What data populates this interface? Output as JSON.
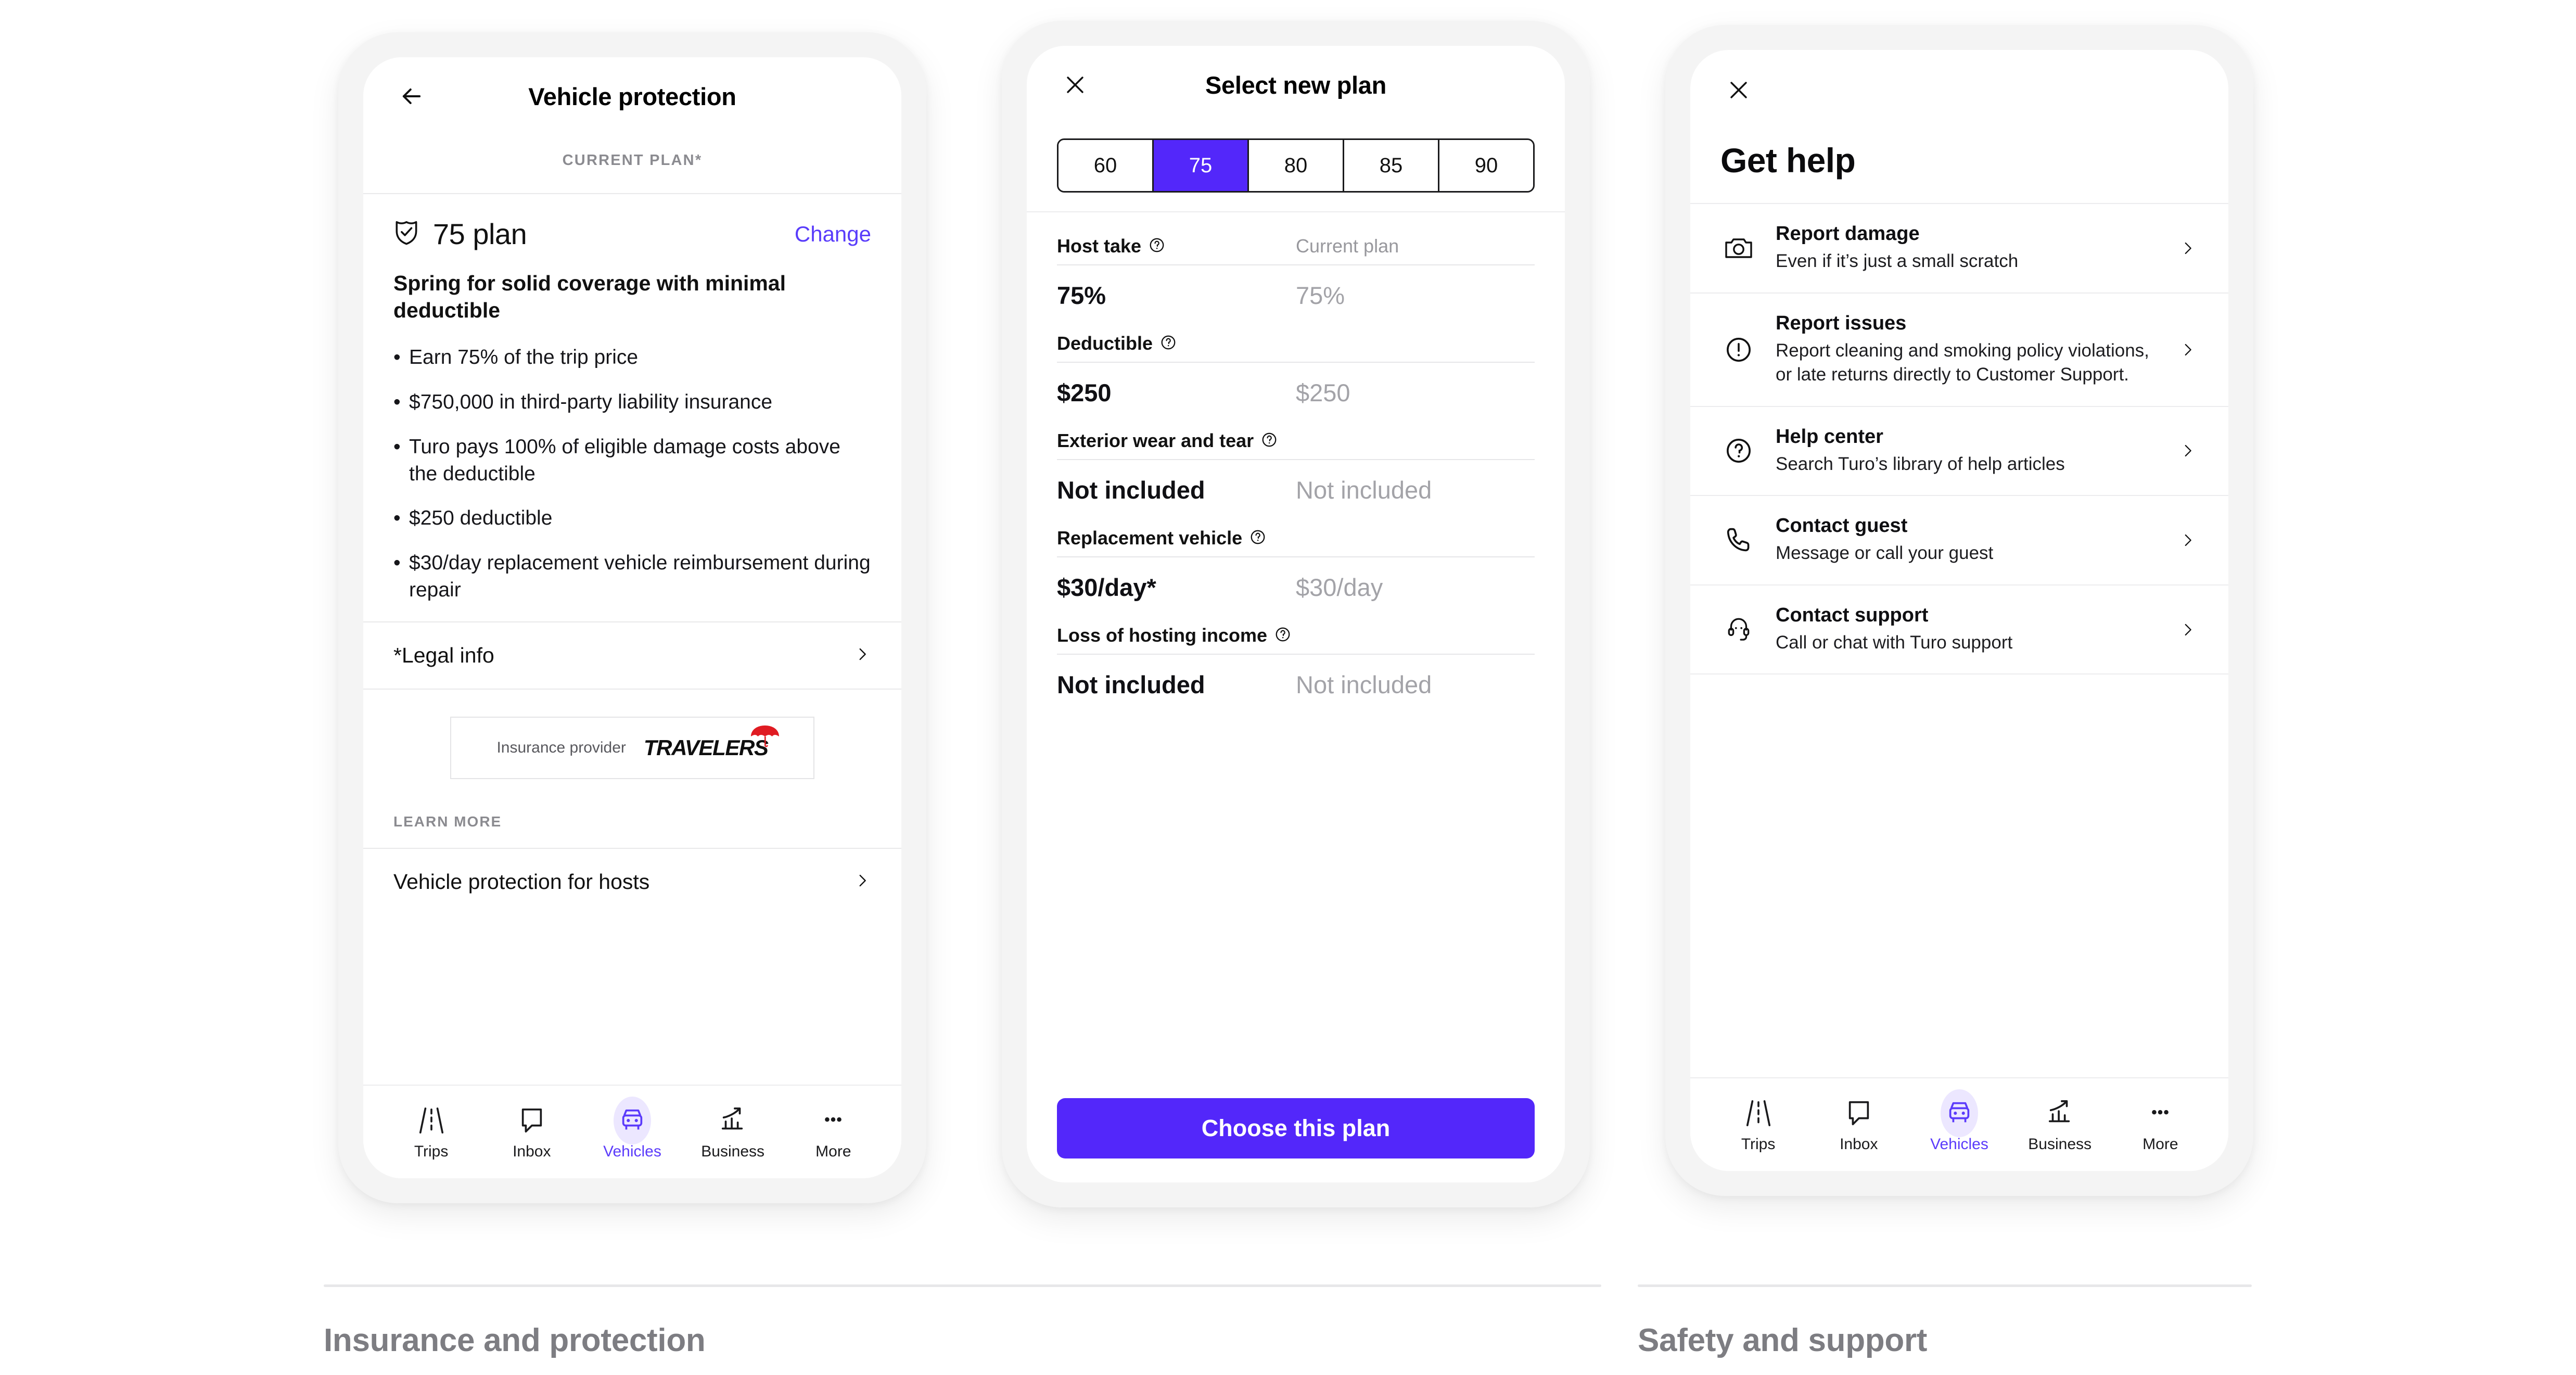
{
  "colors": {
    "accent": "#5327fa",
    "accent_link": "#593cfb",
    "muted": "#98989d",
    "frame": "#f4f4f4"
  },
  "phone1": {
    "appbar": {
      "back_icon": "arrow-left-icon",
      "title": "Vehicle protection"
    },
    "section_label": "CURRENT PLAN*",
    "plan": {
      "shield_icon": "shield-check-icon",
      "name": "75 plan",
      "change_label": "Change",
      "tagline": "Spring for solid coverage with minimal deductible",
      "bullets": [
        "Earn 75% of the trip price",
        "$750,000 in third-party liability insurance",
        "Turo pays 100% of eligible damage costs above the deductible",
        "$250 deductible",
        "$30/day replacement vehicle reimbursement during repair"
      ]
    },
    "legal_row": {
      "label": "*Legal info",
      "chevron_icon": "chevron-right-icon"
    },
    "provider": {
      "label": "Insurance provider",
      "brand": "TRAVELERS",
      "brand_icon": "red-umbrella-icon"
    },
    "learn_more_label": "LEARN MORE",
    "learn_more_row": {
      "label": "Vehicle protection for hosts",
      "chevron_icon": "chevron-right-icon"
    },
    "tabs": [
      {
        "label": "Trips",
        "icon": "road-icon",
        "active": false
      },
      {
        "label": "Inbox",
        "icon": "speech-bubble-icon",
        "active": false
      },
      {
        "label": "Vehicles",
        "icon": "car-front-icon",
        "active": true
      },
      {
        "label": "Business",
        "icon": "bar-chart-arrow-icon",
        "active": false
      },
      {
        "label": "More",
        "icon": "ellipsis-icon",
        "active": false
      }
    ]
  },
  "phone2": {
    "appbar": {
      "close_icon": "close-icon",
      "title": "Select new plan"
    },
    "segments": [
      {
        "label": "60",
        "active": false
      },
      {
        "label": "75",
        "active": true
      },
      {
        "label": "80",
        "active": false
      },
      {
        "label": "85",
        "active": false
      },
      {
        "label": "90",
        "active": false
      }
    ],
    "column_header_right": "Current plan",
    "rows": [
      {
        "title": "Host take",
        "info_icon": "question-circle-icon",
        "new_value": "75%",
        "current_value": "75%"
      },
      {
        "title": "Deductible",
        "info_icon": "question-circle-icon",
        "new_value": "$250",
        "current_value": "$250"
      },
      {
        "title": "Exterior wear and tear",
        "info_icon": "question-circle-icon",
        "new_value": "Not included",
        "current_value": "Not included"
      },
      {
        "title": "Replacement vehicle",
        "info_icon": "question-circle-icon",
        "new_value": "$30/day*",
        "current_value": "$30/day"
      },
      {
        "title": "Loss of hosting income",
        "info_icon": "question-circle-icon",
        "new_value": "Not included",
        "current_value": "Not included"
      }
    ],
    "cta_label": "Choose this plan"
  },
  "phone3": {
    "appbar": {
      "close_icon": "close-icon"
    },
    "title": "Get help",
    "items": [
      {
        "icon": "camera-icon",
        "title": "Report damage",
        "subtitle": "Even if it’s just a small scratch",
        "chevron_icon": "chevron-right-icon"
      },
      {
        "icon": "exclamation-circle-icon",
        "title": "Report issues",
        "subtitle": "Report cleaning and smoking policy violations, or late returns directly to Customer Support.",
        "chevron_icon": "chevron-right-icon"
      },
      {
        "icon": "question-circle-icon",
        "title": "Help center",
        "subtitle": "Search Turo’s library of help articles",
        "chevron_icon": "chevron-right-icon"
      },
      {
        "icon": "phone-icon",
        "title": "Contact guest",
        "subtitle": "Message or call your guest",
        "chevron_icon": "chevron-right-icon"
      },
      {
        "icon": "headset-agent-icon",
        "title": "Contact support",
        "subtitle": "Call or chat with Turo support",
        "chevron_icon": "chevron-right-icon"
      }
    ],
    "tabs": [
      {
        "label": "Trips",
        "icon": "road-icon",
        "active": false
      },
      {
        "label": "Inbox",
        "icon": "speech-bubble-icon",
        "active": false
      },
      {
        "label": "Vehicles",
        "icon": "car-front-icon",
        "active": true
      },
      {
        "label": "Business",
        "icon": "bar-chart-arrow-icon",
        "active": false
      },
      {
        "label": "More",
        "icon": "ellipsis-icon",
        "active": false
      }
    ]
  },
  "footer": {
    "caption_left": "Insurance and protection",
    "caption_right": "Safety and support"
  }
}
